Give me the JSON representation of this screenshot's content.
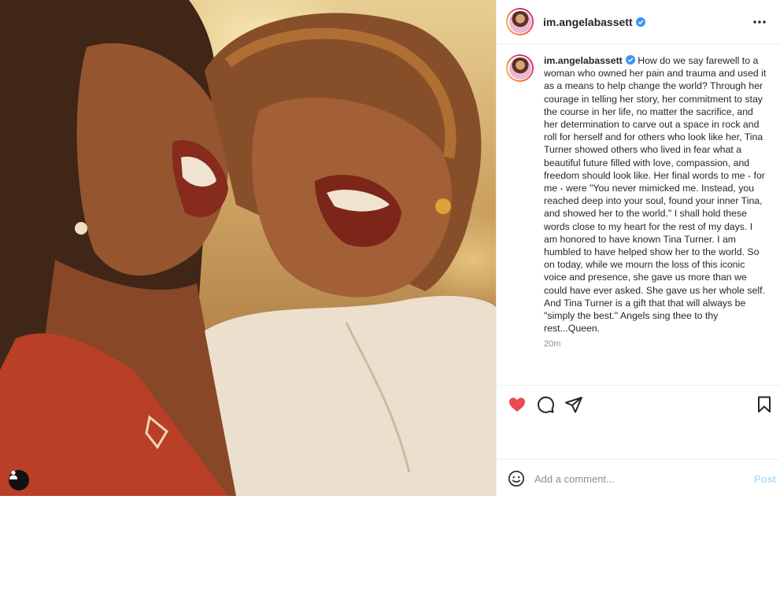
{
  "post": {
    "username": "im.angelabassett",
    "verified": true,
    "caption": "How do we say farewell to a woman who owned her pain and trauma and used it as a means to help change the world? Through her courage in telling her story, her commitment to stay the course in her life, no matter the sacrifice, and her determination to carve out a space in rock and roll for herself and for others who look like her, Tina Turner showed others who lived in fear what a beautiful future filled with love, compassion, and freedom should look like. Her final words to me - for me - were \"You never mimicked me. Instead, you reached deep into your soul, found your inner Tina, and showed her to the world.\" I shall hold these words close to my heart for the rest of my days. I am honored to have known Tina Turner. I am humbled to have helped show her to the world. So on today, while we mourn the loss of this iconic voice and presence, she gave us more than we could have ever asked. She gave us her whole self. And Tina Turner is a gift that that will always be \"simply the best.\" Angels sing thee to thy rest...Queen.",
    "time": "20m",
    "liked": true
  },
  "comment": {
    "placeholder": "Add a comment...",
    "post_label": "Post"
  },
  "colors": {
    "like": "#ed4956",
    "verified": "#3897f0",
    "post_button": "#b2dffc"
  },
  "icons": [
    "verified-badge-icon",
    "more-options-icon",
    "heart-icon",
    "comment-icon",
    "share-icon",
    "bookmark-icon",
    "emoji-icon",
    "user-tag-icon"
  ]
}
